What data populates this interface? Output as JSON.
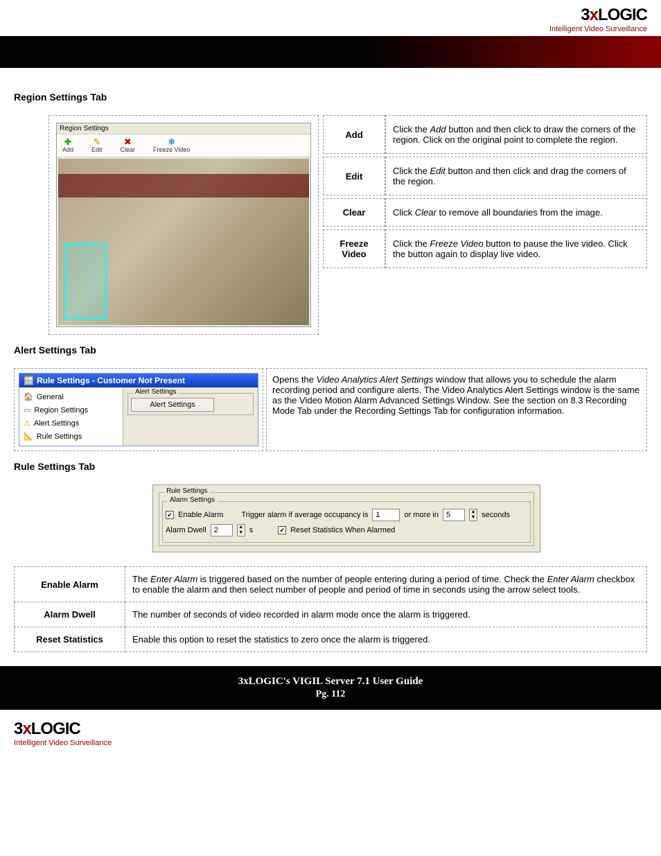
{
  "brand": {
    "name_3": "3",
    "name_x": "x",
    "name_rest": "LOGIC",
    "tagline": "Intelligent Video Surveillance"
  },
  "sections": {
    "region_title": "Region Settings Tab",
    "alert_title": "Alert Settings Tab",
    "rule_title": "Rule Settings Tab"
  },
  "region_panel": {
    "title": "Region Settings",
    "toolbar": {
      "add": "Add",
      "edit": "Edit",
      "clear": "Clear",
      "freeze": "Freeze Video"
    }
  },
  "region_table": {
    "add": {
      "head": "Add",
      "body_pre": "Click the ",
      "body_em": "Add",
      "body_post": " button and then click to draw the corners of the region. Click on the original point to complete the region."
    },
    "edit": {
      "head": "Edit",
      "body_pre": "Click the ",
      "body_em": "Edit",
      "body_post": " button and then click and drag the corners of the region."
    },
    "clear": {
      "head": "Clear",
      "body_pre": "Click ",
      "body_em": "Clear",
      "body_post": " to remove all boundaries from the image."
    },
    "freeze": {
      "head": "Freeze Video",
      "body_pre": "Click the ",
      "body_em": "Freeze Video",
      "body_post": " button to pause the live video. Click the button again to display live video."
    }
  },
  "alert_window": {
    "titlebar": "Rule Settings - Customer Not Present",
    "nav": {
      "general": "General",
      "region": "Region Settings",
      "alert": "Alert Settings",
      "rule": "Rule Settings"
    },
    "fieldset_legend": "Alert Settings",
    "button": "Alert Settings"
  },
  "alert_desc": {
    "p1_pre": "Opens the ",
    "p1_em": "Video Analytics Alert Settings",
    "p1_post": " window that allows you to schedule the alarm recording period and configure alerts.  The Video Analytics Alert Settings window is the same as the Video Motion Alarm Advanced Settings Window.  See the section on 8.3 Recording Mode Tab under the Recording Settings Tab for configuration information."
  },
  "rule_panel": {
    "fs1": "Rule Settings",
    "fs2": "Alarm Settings",
    "enable_alarm": "Enable Alarm",
    "trigger_text1": "Trigger alarm if average occupancy is",
    "occupancy_val": "1",
    "or_more_in": "or more in",
    "seconds_val": "5",
    "seconds_label": "seconds",
    "alarm_dwell": "Alarm Dwell",
    "dwell_val": "2",
    "dwell_unit": "s",
    "reset_stats": "Reset Statistics When Alarmed"
  },
  "rule_table": {
    "enable": {
      "head": "Enable Alarm",
      "pre": "The ",
      "em1": "Enter Alarm",
      "mid": " is triggered based on the number of people entering during a period of time. Check the ",
      "em2": "Enter Alarm",
      "post": " checkbox to enable the alarm and then select number of people and period of time in seconds using the arrow select tools."
    },
    "dwell": {
      "head": "Alarm Dwell",
      "body": "The number of seconds of video recorded in alarm mode once the alarm is triggered."
    },
    "reset": {
      "head": "Reset Statistics",
      "body": "Enable this option to reset the statistics to zero once the alarm is triggered."
    }
  },
  "footer": {
    "title": "3xLOGIC's VIGIL Server 7.1 User Guide",
    "page": "Pg. 112"
  }
}
